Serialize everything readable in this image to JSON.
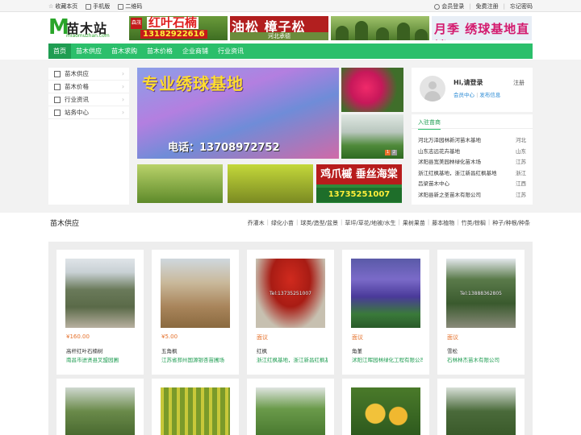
{
  "topbar": {
    "left": [
      "收藏本页",
      "手机版",
      "二维码"
    ],
    "right": [
      "会员登录",
      "免费注册",
      "忘记密码"
    ]
  },
  "logo": {
    "mark": "M",
    "name": "苗木站",
    "domain": "miaomuzhan.com"
  },
  "ads": {
    "ad1": {
      "badge": "森茂",
      "title": "红叶石楠",
      "phone": "13182922616"
    },
    "ad2": {
      "title": "油松 樟子松",
      "sub": "河北承德"
    },
    "ad4": {
      "title": "月季 绣球基地直销"
    }
  },
  "nav": [
    "首页",
    "苗木供应",
    "苗木求购",
    "苗木价格",
    "企业商铺",
    "行业资讯"
  ],
  "sidebar": [
    {
      "label": "苗木供应",
      "icon": "list-icon"
    },
    {
      "label": "苗木价格",
      "icon": "price-icon"
    },
    {
      "label": "行业资讯",
      "icon": "news-icon"
    },
    {
      "label": "站务中心",
      "icon": "service-icon"
    }
  ],
  "banner": {
    "headline": "专业绣球基地",
    "phone": "电话：13708972752",
    "dots": [
      "1",
      "2"
    ]
  },
  "side_ad3": {
    "title": "鸡爪槭 垂丝海棠",
    "phone": "13735251007"
  },
  "user": {
    "greeting": "Hi,请登录",
    "register": "注册",
    "center": "会员中心",
    "post": "发布信息",
    "divider": "|"
  },
  "members": {
    "title": "入驻苗商",
    "items": [
      {
        "name": "河北万泽园林新河苗木基地",
        "prov": "河北"
      },
      {
        "name": "山东志远花卉基地",
        "prov": "山东"
      },
      {
        "name": "沭阳县宽美园林绿化苗木场",
        "prov": "江苏"
      },
      {
        "name": "浙江红枫基地，浙江新昌红枫基地",
        "prov": "浙江"
      },
      {
        "name": "吕梁苗木中心",
        "prov": "江西"
      },
      {
        "name": "沭阳县新之圣苗木有限公司",
        "prov": "江苏"
      }
    ]
  },
  "supply": {
    "title": "苗木供应",
    "categories": [
      "乔灌木",
      "绿化小苗",
      "球类/造型/盆景",
      "草坪/草花/地被/水生",
      "果树果苗",
      "藤本植物",
      "竹类/棕榈",
      "种子/种根/种条"
    ],
    "divider": "|",
    "cards": [
      {
        "price": "¥160.00",
        "name": "高杆红叶石楠树",
        "company": "南昌市进贤县叉盟园圃"
      },
      {
        "price": "¥5.00",
        "name": "五角枫",
        "company": "江苏省邳州国源银杏苗圃场"
      },
      {
        "price": "面议",
        "name": "红枫",
        "company": "浙江红枫基地，浙江新昌红枫基地",
        "tel": "Tel:13735251007"
      },
      {
        "price": "面议",
        "name": "角堇",
        "company": "沭阳江晖园林绿化工程有限公司"
      },
      {
        "price": "面议",
        "name": "雪松",
        "company": "石林林杰苗木有限公司",
        "tel": "Tel:13888362805"
      }
    ]
  },
  "colors": {
    "brand": "#2bbf6b",
    "brand_dark": "#1f9d52",
    "price": "#e5702a",
    "link": "#2a8ad4"
  }
}
